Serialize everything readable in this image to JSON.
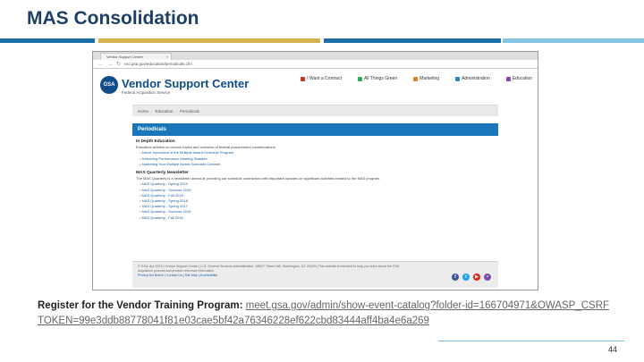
{
  "slide": {
    "title": "MAS Consolidation",
    "page_number": "44",
    "register_label": "Register for the Vendor Training Program:",
    "register_link": "meet.gsa.gov/admin/show-event-catalog?folder-id=166704971&OWASP_CSRFTOKEN=99e3ddb88778041f81e03cae5bf42a76346228ef622cbd83444aff4ba4e6a269",
    "colors": {
      "title": "#1e3f66",
      "stripe_blue": "#1b6ea6",
      "stripe_gold": "#d3b14c",
      "stripe_light": "#86c6e4"
    }
  },
  "browser": {
    "tab_title": "Vendor Support Center",
    "tab_close": "×",
    "nav_back": "←",
    "nav_forward": "→",
    "nav_reload": "↻",
    "url": "vsc.gsa.gov/education/periodicals.cfm"
  },
  "site": {
    "logo": "GSA",
    "title": "Vendor Support Center",
    "subtitle": "Federal Acquisition Service",
    "nav": [
      {
        "label": "I Want a Contract",
        "color": "#c0392b",
        "icon": "contract-icon"
      },
      {
        "label": "All Things Green",
        "color": "#27ae60",
        "icon": "green-icon"
      },
      {
        "label": "Marketing",
        "color": "#e67e22",
        "icon": "marketing-icon"
      },
      {
        "label": "Administration",
        "color": "#2e86c1",
        "icon": "administration-icon"
      },
      {
        "label": "Education",
        "color": "#8e44ad",
        "icon": "education-icon"
      }
    ],
    "breadcrumb": [
      "Home",
      "Education",
      "Periodicals"
    ],
    "breadcrumb_sep": "›",
    "banner": "Periodicals",
    "in_depth": {
      "heading": "In Depth Education",
      "desc": "Education articles on various topics and overview of federal procurement considerations.",
      "items": [
        "Article Innovation in the Multiple Award Schedule Program",
        "Delivering Performance Meeting Statutes",
        "Marketing Your Multiple Award Schedule Contract"
      ]
    },
    "newsletter": {
      "heading": "MAS Quarterly Newsletter",
      "desc": "The MAS Quarterly is a newsletter aimed at providing our schedule contractors with important updates on significant activities related to the MAS program.",
      "items": [
        "MAS Quarterly - Spring 2019",
        "MAS Quarterly - Summer 2019",
        "MAS Quarterly - Fall 2018",
        "MAS Quarterly - Spring 2018",
        "MAS Quarterly - Spring 2017",
        "MAS Quarterly - Summer 2016",
        "MAS Quarterly - Fall 2016"
      ]
    },
    "footer": {
      "legal": "© GSA, Apr 2019 | Vendor Support Center | U.S. General Services Administration, 1800 F Street NW, Washington, DC 20405 | This website is intended to help you learn about the GSA acquisition process and provide reference information.",
      "links": "Privacy Act Notice | Contact Us | Site Map | Accessibility"
    },
    "socials": [
      {
        "name": "facebook-icon",
        "glyph": "f",
        "color": "#3b5998"
      },
      {
        "name": "twitter-icon",
        "glyph": "t",
        "color": "#1da1f2"
      },
      {
        "name": "youtube-icon",
        "glyph": "▶",
        "color": "#e62117"
      },
      {
        "name": "flickr-icon",
        "glyph": "•",
        "color": "#7d4ea8"
      }
    ]
  }
}
